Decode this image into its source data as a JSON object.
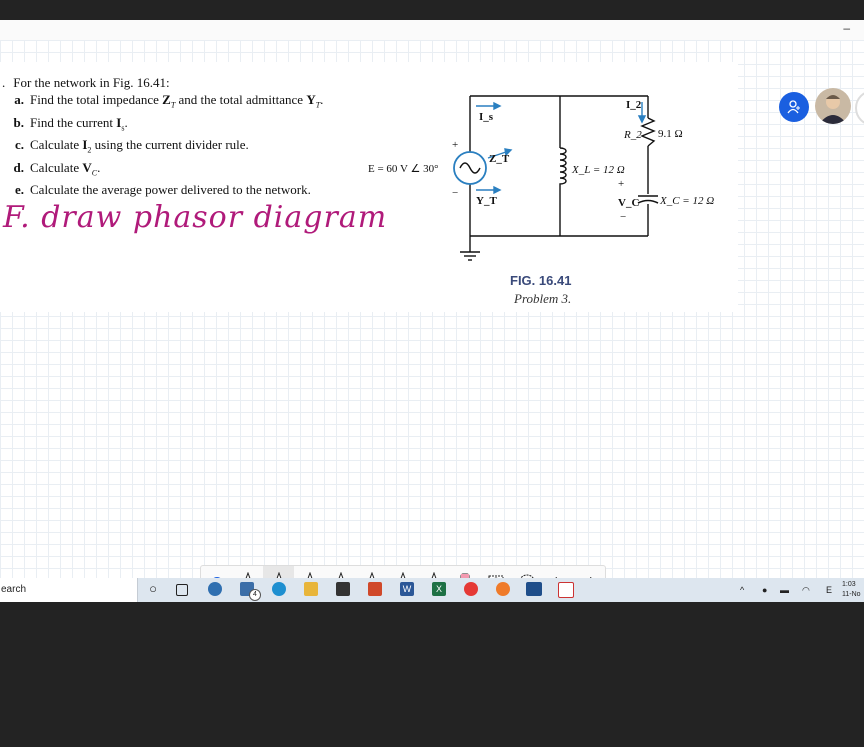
{
  "problem": {
    "intro": "For the network in Fig. 16.41:",
    "items": [
      {
        "label": "a.",
        "text": "Find the total impedance Z_T and the total admittance Y_T."
      },
      {
        "label": "b.",
        "text": "Find the current I_s."
      },
      {
        "label": "c.",
        "text": "Calculate I_2 using the current divider rule."
      },
      {
        "label": "d.",
        "text": "Calculate V_C."
      },
      {
        "label": "e.",
        "text": "Calculate the average power delivered to the network."
      }
    ],
    "handwritten": "F. draw phasor diagram"
  },
  "circuit": {
    "source": "E = 60 V ∠ 30°",
    "plus": "+",
    "minus": "−",
    "is": "I_s",
    "zt": "Z_T",
    "yt": "Y_T",
    "xl": "X_L = 12 Ω",
    "i2": "I_2",
    "r2": "R_2",
    "r2val": "9.1 Ω",
    "vc": "V_C",
    "xc": "X_C = 12 Ω"
  },
  "figure": {
    "caption": "FIG. 16.41",
    "sub": "Problem 3."
  },
  "window": {
    "minimize": "–"
  },
  "toolbar": {
    "tools": [
      "check-circle",
      "pen-black",
      "pen-magenta",
      "pen-blue",
      "pen-green",
      "pen-orange",
      "pen-blue-2",
      "pencil",
      "eraser",
      "lasso-select",
      "ruler-lasso",
      "undo",
      "redo"
    ]
  },
  "taskbar": {
    "search": "earch",
    "badge": "4",
    "time": "1:03",
    "date": "11-No"
  },
  "colors": {
    "accent": "#1a5fe0",
    "ink": "#b01a7a",
    "caption": "#3a4a7a"
  }
}
